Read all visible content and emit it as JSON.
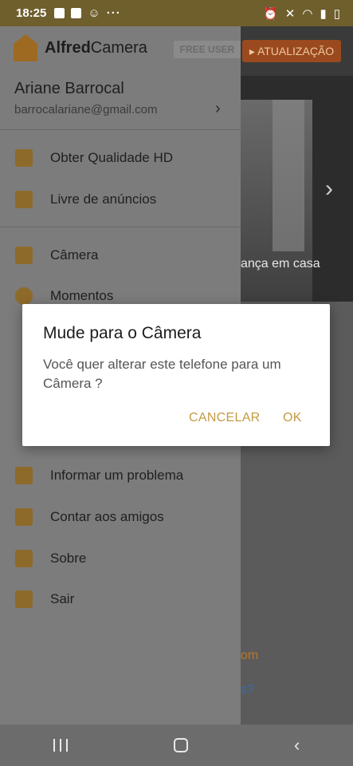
{
  "status_bar": {
    "time": "18:25",
    "more": "···"
  },
  "background": {
    "upgrade_label": "▸ ATUALIZAÇÃO",
    "caption": "ança em casa",
    "link1": "om",
    "link2": "s?"
  },
  "drawer": {
    "brand_bold": "Alfred",
    "brand_rest": "Camera",
    "badge": "FREE USER",
    "user_name": "Ariane Barrocal",
    "user_email": "barrocalariane@gmail.com",
    "items": [
      {
        "label": "Obter Qualidade HD",
        "icon": "hd-icon"
      },
      {
        "label": "Livre de anúncios",
        "icon": "no-ads-icon"
      },
      {
        "label": "Câmera",
        "icon": "switch-camera-icon"
      },
      {
        "label": "Momentos",
        "icon": "cloud-icon"
      },
      {
        "label": "Informar um problema",
        "icon": "mail-icon"
      },
      {
        "label": "Contar aos amigos",
        "icon": "chat-icon"
      },
      {
        "label": "Sobre",
        "icon": "alfred-logo-icon"
      },
      {
        "label": "Sair",
        "icon": "logout-icon"
      }
    ]
  },
  "dialog": {
    "title": "Mude para o Câmera",
    "message": "Você quer alterar este telefone para um Câmera ?",
    "cancel": "CANCELAR",
    "ok": "OK"
  }
}
